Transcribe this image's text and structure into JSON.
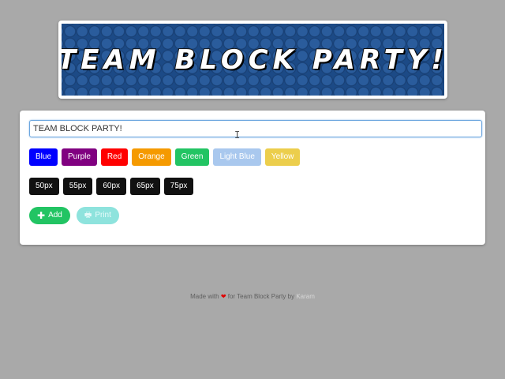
{
  "banner": {
    "title": "TEAM BLOCK PARTY!"
  },
  "input": {
    "value": "TEAM BLOCK PARTY!"
  },
  "colors": [
    {
      "label": "Blue",
      "hex": "#0000ff"
    },
    {
      "label": "Purple",
      "hex": "#800080"
    },
    {
      "label": "Red",
      "hex": "#ff0000"
    },
    {
      "label": "Orange",
      "hex": "#f59a00"
    },
    {
      "label": "Green",
      "hex": "#22c463"
    },
    {
      "label": "Light Blue",
      "hex": "#a9c8ee"
    },
    {
      "label": "Yellow",
      "hex": "#ecce4c"
    }
  ],
  "sizes": [
    "50px",
    "55px",
    "60px",
    "65px",
    "75px"
  ],
  "actions": {
    "add_label": "Add",
    "print_label": "Print"
  },
  "footer": {
    "made_with": "Made with",
    "for_text": "for Team Block Party by",
    "author": "Karam"
  }
}
